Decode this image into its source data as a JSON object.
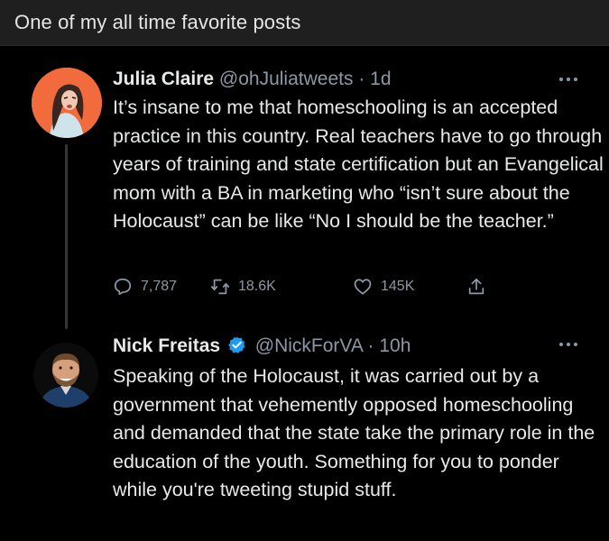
{
  "post": {
    "title": "One of my all time favorite posts"
  },
  "tweets": [
    {
      "name": "Julia Claire",
      "handle": "@ohJuliatweets",
      "time": "· 1d",
      "text": "It’s insane to me that homeschooling is an accepted practice in this country. Real teachers have to go through years of training and state certification but an Evangelical mom with a BA in marketing who “isn’t sure about the Holocaust” can be like “No I should be the teacher.”",
      "replies": "7,787",
      "retweets": "18.6K",
      "likes": "145K"
    },
    {
      "name": "Nick Freitas",
      "handle": "@NickForVA",
      "time": "· 10h",
      "verified": true,
      "text": "Speaking of the Holocaust, it was carried out by a government that vehemently opposed homeschooling and demanded that the state take the primary role in the education of the youth. Something for you to ponder while you're tweeting stupid stuff."
    }
  ],
  "icons": {
    "reply": "reply-icon",
    "retweet": "retweet-icon",
    "like": "heart-icon",
    "share": "share-icon",
    "more": "more-icon",
    "verified": "verified-badge-icon"
  },
  "colors": {
    "background": "#000000",
    "header_bar": "#1f1f1f",
    "text": "#e7e9ea",
    "muted": "#8b98a5",
    "verified": "#1d9bf0",
    "avatar_julia_bg": "#f26b3c"
  }
}
